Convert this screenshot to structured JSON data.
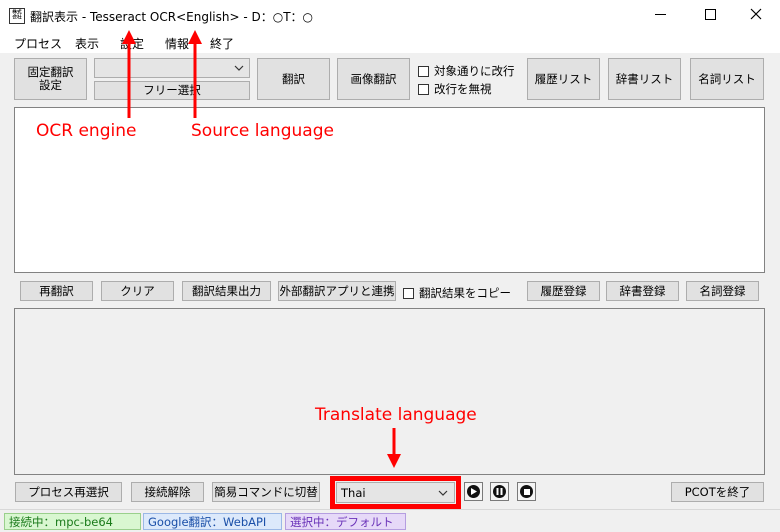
{
  "window": {
    "title": "翻訳表示 - Tesseract OCR<English> - D：○T：○",
    "app_icon_glyph": "㍿"
  },
  "menu": [
    "プロセス",
    "表示",
    "設定",
    "情報",
    "終了"
  ],
  "toolbar": {
    "fixed_translation_settings": "固定翻訳\n設定",
    "combo_value": "",
    "free_select": "フリー選択",
    "translate": "翻訳",
    "image_translate": "画像翻訳",
    "newline_by_target": "対象通りに改行",
    "ignore_newlines": "改行を無視",
    "history_list": "履歴リスト",
    "dictionary_list": "辞書リスト",
    "noun_list": "名詞リスト"
  },
  "middle_bar": {
    "retranslate": "再翻訳",
    "clear": "クリア",
    "output_result": "翻訳結果出力",
    "external_app": "外部翻訳アプリと連携",
    "copy_result": "翻訳結果をコピー",
    "register_history": "履歴登録",
    "register_dictionary": "辞書登録",
    "register_noun": "名詞登録"
  },
  "bottom_bar": {
    "reselect_process": "プロセス再選択",
    "disconnect": "接続解除",
    "simple_command": "簡易コマンドに切替",
    "language_value": "Thai",
    "exit_pcot": "PCOTを終了"
  },
  "status": {
    "connected": "接続中：mpc-be64",
    "google": "Google翻訳：WebAPI",
    "selected": "選択中：デフォルト"
  },
  "annotations": {
    "ocr_engine": "OCR engine",
    "source_language": "Source language",
    "translate_language": "Translate language"
  },
  "colors": {
    "annotation": "#ff0000",
    "status_connected_bg": "#d9f7d1",
    "status_google_bg": "#dce9fb",
    "status_selected_bg": "#e6d9f8"
  }
}
